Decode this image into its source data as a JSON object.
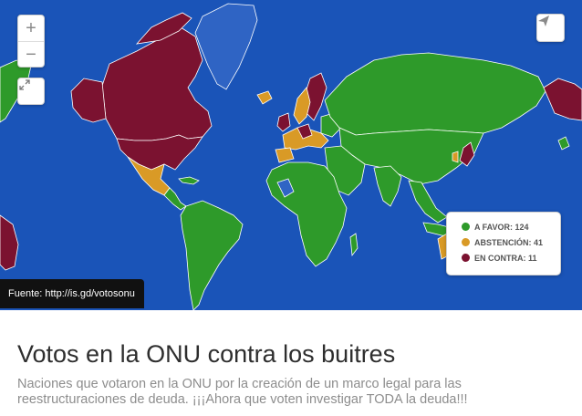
{
  "map": {
    "zoom_in_label": "+",
    "zoom_out_label": "−",
    "fullscreen_icon": "expand-arrows-icon",
    "share_icon": "paper-plane-icon",
    "colors": {
      "ocean": "#1a54b8",
      "favor": "#2e9a2a",
      "abstention": "#d99a26",
      "against": "#7b1230",
      "no_vote": "#2f64c4",
      "border": "#ffffff"
    }
  },
  "legend": {
    "items": [
      {
        "label": "A FAVOR: 124",
        "color": "#2e9a2a"
      },
      {
        "label": "ABSTENCIÓN: 41",
        "color": "#d99a26"
      },
      {
        "label": "EN CONTRA: 11",
        "color": "#7b1230"
      }
    ]
  },
  "source": {
    "text": "Fuente: http://is.gd/votosonu"
  },
  "title": "Votos en la ONU contra los buitres",
  "description": "Naciones que votaron en la ONU por la creación de un marco legal para las reestructuraciones de deuda. ¡¡¡Ahora que voten investigar TODA la deuda!!!"
}
